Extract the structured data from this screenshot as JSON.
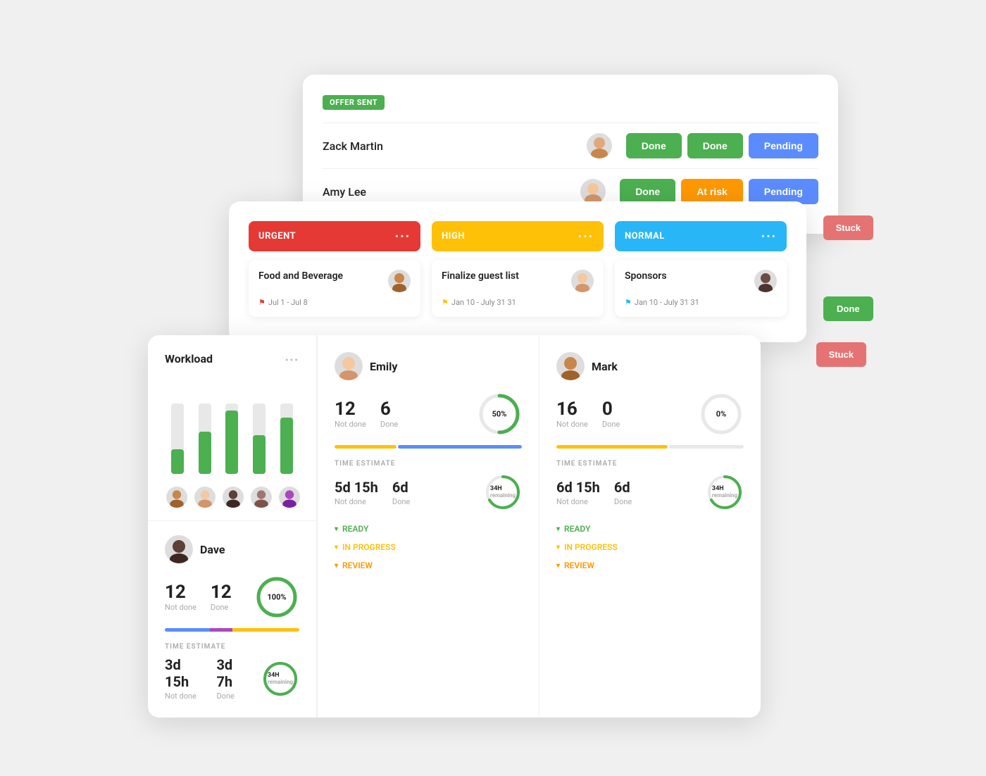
{
  "offerCard": {
    "badge": "OFFER SENT",
    "rows": [
      {
        "name": "Zack Martin",
        "statuses": [
          "Done",
          "Done",
          "Pending"
        ],
        "statusTypes": [
          "done",
          "done",
          "pending"
        ]
      },
      {
        "name": "Amy Lee",
        "statuses": [
          "Done",
          "At risk",
          "Pending"
        ],
        "statusTypes": [
          "done",
          "atrisk",
          "pending"
        ]
      }
    ]
  },
  "kanbanCard": {
    "columns": [
      {
        "label": "URGENT",
        "color": "urgent",
        "task": {
          "title": "Food and Beverage",
          "date": "Jul 1 - Jul 8",
          "flagColor": "red"
        }
      },
      {
        "label": "HIGH",
        "color": "high",
        "task": {
          "title": "Finalize guest list",
          "date": "Jan 10 - July 31 31",
          "flagColor": "yellow"
        }
      },
      {
        "label": "NORMAL",
        "color": "normal",
        "task": {
          "title": "Sponsors",
          "date": "Jan 10 - July 31 31",
          "flagColor": "blue"
        }
      }
    ],
    "edgeButtons": [
      "Stuck",
      "Done",
      "Stuck"
    ]
  },
  "workloadCard": {
    "title": "Workload",
    "bars": [
      {
        "total": 100,
        "filled": 35
      },
      {
        "total": 100,
        "filled": 60
      },
      {
        "total": 100,
        "filled": 90
      },
      {
        "total": 100,
        "filled": 55
      },
      {
        "total": 100,
        "filled": 80
      }
    ],
    "dave": {
      "name": "Dave",
      "notDone": 12,
      "done": 12,
      "percent": "100%",
      "timeEstLabel": "TIME ESTIMATE",
      "notDoneTime": "3d 15h",
      "doneTime": "3d 7h",
      "remaining": "34H"
    },
    "emily": {
      "name": "Emily",
      "notDone": 12,
      "done": 6,
      "percent": "50%",
      "timeEstLabel": "TIME ESTIMATE",
      "notDoneTime": "5d 15h",
      "doneTime": "6d",
      "remaining": "34H",
      "sections": [
        "READY",
        "IN PROGRESS",
        "REVIEW"
      ]
    },
    "mark": {
      "name": "Mark",
      "notDone": 16,
      "done": 0,
      "percent": "0%",
      "timeEstLabel": "TIME ESTIMATE",
      "notDoneTime": "6d 15h",
      "doneTime": "6d",
      "remaining": "34H",
      "sections": [
        "READY",
        "IN PROGRESS",
        "REVIEW"
      ]
    }
  }
}
